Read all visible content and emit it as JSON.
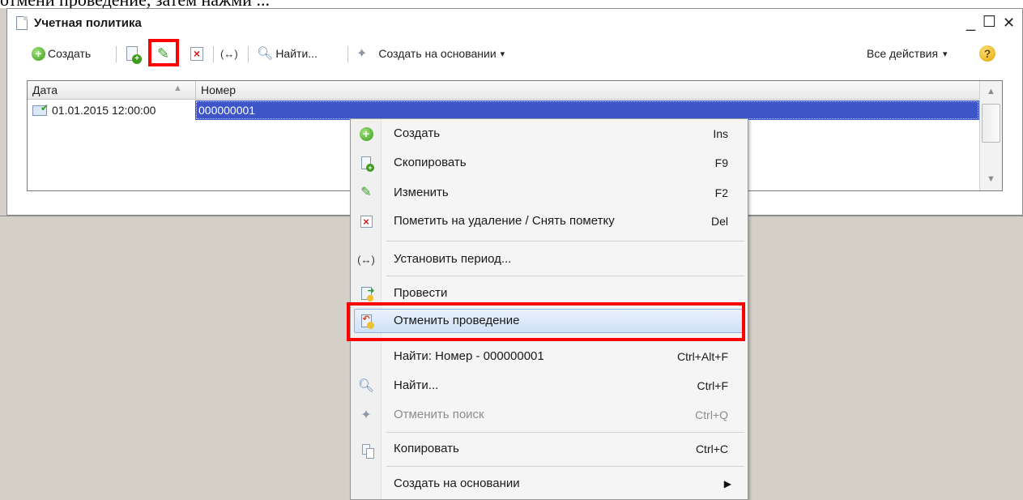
{
  "doc_text": "отмени проведение, затем нажми ...",
  "window": {
    "title": "Учетная политика",
    "controls": {
      "minimize": "_",
      "maximize": "☐",
      "close": "✕"
    }
  },
  "toolbar": {
    "create": "Создать",
    "find": "Найти...",
    "create_based_on": "Создать на основании",
    "dropdown_arrow": "▾",
    "all_actions": "Все действия",
    "help": "?",
    "period_glyph": "(↔)"
  },
  "grid": {
    "columns": [
      "Дата",
      "Номер"
    ],
    "rows": [
      {
        "date": "01.01.2015 12:00:00",
        "number": "000000001",
        "selected": true
      }
    ]
  },
  "context_menu": {
    "items": [
      {
        "label": "Создать",
        "key": "Ins",
        "icon": "create-icon"
      },
      {
        "label": "Скопировать",
        "key": "F9",
        "icon": "copy-icon"
      },
      {
        "label": "Изменить",
        "key": "F2",
        "icon": "edit-icon"
      },
      {
        "label": "Пометить на удаление / Снять пометку",
        "key": "Del",
        "icon": "delete-mark-icon"
      },
      {
        "label": "Установить период...",
        "key": "",
        "icon": "period-icon"
      },
      {
        "label": "Провести",
        "key": "",
        "icon": "post-icon"
      },
      {
        "label": "Отменить проведение",
        "key": "",
        "icon": "unpost-icon",
        "highlighted": true
      },
      {
        "label": "Найти: Номер - 000000001",
        "key": "Ctrl+Alt+F",
        "icon": ""
      },
      {
        "label": "Найти...",
        "key": "Ctrl+F",
        "icon": "search-icon"
      },
      {
        "label": "Отменить поиск",
        "key": "Ctrl+Q",
        "icon": "cancel-search-icon",
        "disabled": true
      },
      {
        "label": "Копировать",
        "key": "Ctrl+C",
        "icon": "copy-clipboard-icon"
      },
      {
        "label": "Создать на основании",
        "key": "",
        "icon": "",
        "submenu": true
      }
    ]
  },
  "colors": {
    "selection": "#3d55c8",
    "highlight_box": "#ff0000",
    "background": "#d4d0c8"
  }
}
